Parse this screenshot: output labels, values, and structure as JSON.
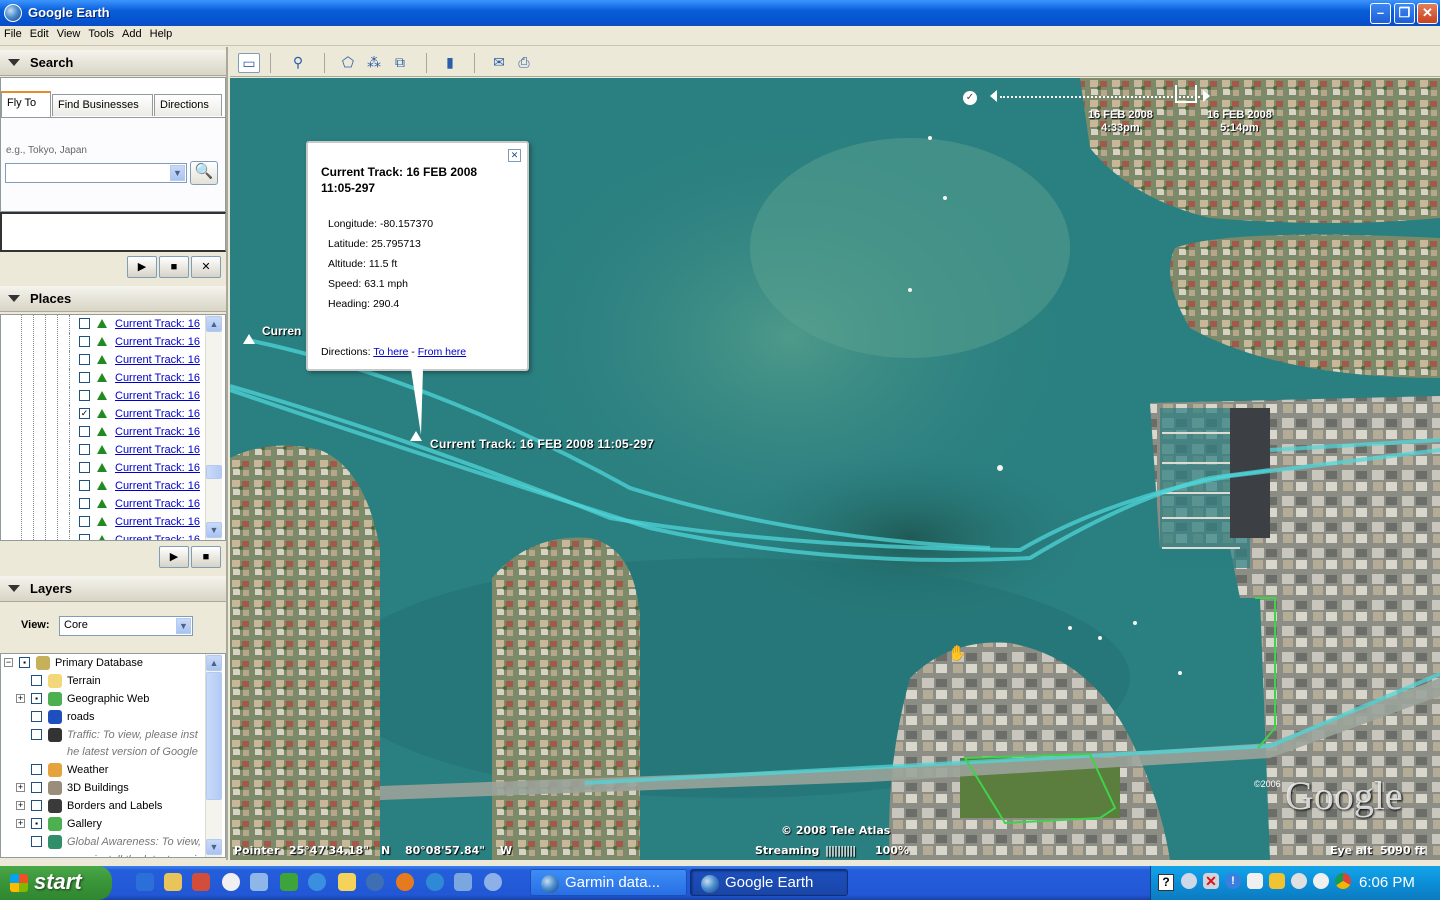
{
  "window": {
    "title": "Google Earth"
  },
  "menu": [
    "File",
    "Edit",
    "View",
    "Tools",
    "Add",
    "Help"
  ],
  "search": {
    "header": "Search",
    "tabs": [
      "Fly To",
      "Find Businesses",
      "Directions"
    ],
    "active_tab": "Fly To",
    "hint": "e.g., Tokyo, Japan",
    "value": "",
    "play": "▶",
    "stop": "■",
    "clear": "✕"
  },
  "places": {
    "header": "Places",
    "items": [
      {
        "label": "Current Track: 16",
        "checked": false
      },
      {
        "label": "Current Track: 16",
        "checked": false
      },
      {
        "label": "Current Track: 16",
        "checked": false
      },
      {
        "label": "Current Track: 16",
        "checked": false
      },
      {
        "label": "Current Track: 16",
        "checked": false
      },
      {
        "label": "Current Track: 16",
        "checked": true
      },
      {
        "label": "Current Track: 16",
        "checked": false
      },
      {
        "label": "Current Track: 16",
        "checked": false
      },
      {
        "label": "Current Track: 16",
        "checked": false
      },
      {
        "label": "Current Track: 16",
        "checked": false
      },
      {
        "label": "Current Track: 16",
        "checked": false
      },
      {
        "label": "Current Track: 16",
        "checked": false
      },
      {
        "label": "Current Track: 16",
        "checked": false
      }
    ]
  },
  "layers": {
    "header": "Layers",
    "view_label": "View:",
    "view_value": "Core",
    "items": [
      {
        "label": "Primary Database",
        "icon": "database-icon",
        "italic": false
      },
      {
        "label": "Terrain",
        "icon": "folder-icon",
        "italic": false
      },
      {
        "label": "Geographic Web",
        "icon": "star-icon",
        "italic": false
      },
      {
        "label": "roads",
        "icon": "road-sign-icon",
        "italic": false
      },
      {
        "label": "Traffic: To view, please inst",
        "icon": "traffic-light-icon",
        "italic": true
      },
      {
        "label": "he latest version of Google",
        "icon": "",
        "italic": true
      },
      {
        "label": "Weather",
        "icon": "weather-icon",
        "italic": false
      },
      {
        "label": "3D Buildings",
        "icon": "buildings-icon",
        "italic": false
      },
      {
        "label": "Borders and Labels",
        "icon": "flag-icon",
        "italic": false
      },
      {
        "label": "Gallery",
        "icon": "star-icon",
        "italic": false
      },
      {
        "label": "Global Awareness: To view,",
        "icon": "globe-icon",
        "italic": true
      },
      {
        "label": "ease install the latest versic",
        "icon": "",
        "italic": true
      }
    ]
  },
  "balloon": {
    "title": "Current Track: 16 FEB 2008 11:05-297",
    "fields": [
      "Longitude: -80.157370",
      "Latitude: 25.795713",
      "Altitude: 11.5 ft",
      "Speed: 63.1 mph",
      "Heading: 290.4"
    ],
    "directions_label": "Directions:",
    "to_here": "To here",
    "separator": "-",
    "from_here": "From here"
  },
  "map": {
    "track_label": "Current Track: 16 FEB 2008 11:05-297",
    "partial_label": "Curren",
    "time_start_date": "16 FEB 2008",
    "time_start_time": "4:33pm",
    "time_end_date": "16 FEB 2008",
    "time_end_time": "5:14pm",
    "copyright_year": "©2006",
    "logo": "Google",
    "attribution": "© 2008 Tele Atlas",
    "pointer_label": "Pointer",
    "pointer_lat": "25°47'34.18\"",
    "pointer_lat_dir": "N",
    "pointer_lon": "80°08'57.84\"",
    "pointer_lon_dir": "W",
    "streaming_label": "Streaming",
    "streaming_bars": "||||||||||",
    "streaming_pct": "100%",
    "eye_alt_label": "Eye alt",
    "eye_alt_value": "5090 ft",
    "colors": {
      "water": "#2a7f80",
      "track": "#4fd6d8"
    }
  },
  "taskbar": {
    "start": "start",
    "tasks": [
      {
        "label": "Garmin data...",
        "active": false
      },
      {
        "label": "Google Earth",
        "active": true
      }
    ],
    "clock": "6:06 PM"
  }
}
